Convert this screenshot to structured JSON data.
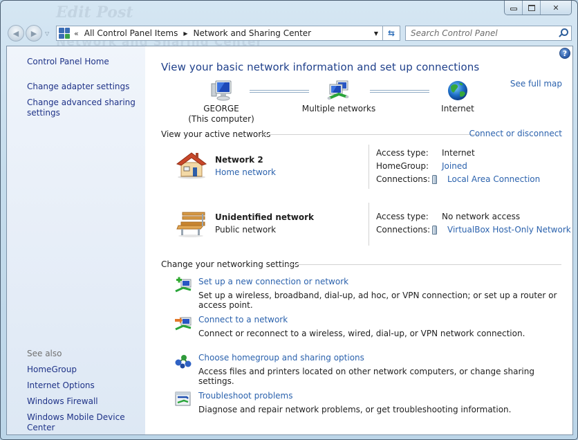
{
  "window": {
    "background_title": "Edit Post",
    "background_subtitle": "Network and Sharing Center",
    "caption": {
      "minimize_icon": "minimize-icon",
      "maximize_icon": "maximize-icon",
      "close_icon": "close-icon",
      "close_glyph": "✕"
    }
  },
  "navigation": {
    "back_icon": "back-arrow-icon",
    "forward_icon": "forward-arrow-icon",
    "history_glyph": "▽",
    "back_glyph": "◀",
    "forward_glyph": "▶"
  },
  "address": {
    "overflow_glyph": "«",
    "separator_glyph": "▶",
    "dropdown_glyph": "▼",
    "breadcrumbs": [
      "All Control Panel Items",
      "Network and Sharing Center"
    ],
    "refresh_glyph": "⇆"
  },
  "search": {
    "placeholder": "Search Control Panel",
    "value": ""
  },
  "sidebar": {
    "home": "Control Panel Home",
    "tasks": [
      "Change adapter settings",
      "Change advanced sharing",
      "settings"
    ],
    "see_also_label": "See also",
    "see_also": [
      "HomeGroup",
      "Internet Options",
      "Windows Firewall",
      "Windows Mobile Device Center"
    ]
  },
  "main": {
    "help_glyph": "?",
    "title": "View your basic network information and set up connections",
    "map": {
      "computer_name": "GEORGE",
      "computer_note": "(This computer)",
      "middle": "Multiple networks",
      "internet": "Internet",
      "see_full_map": "See full map"
    },
    "active_networks": {
      "heading": "View your active networks",
      "connect_link": "Connect or disconnect",
      "networks": [
        {
          "name": "Network  2",
          "type": "Home network",
          "type_is_link": true,
          "icon": "house-icon",
          "details": [
            {
              "label": "Access type:",
              "value": "Internet"
            },
            {
              "label": "HomeGroup:",
              "value": "Joined"
            },
            {
              "label": "Connections:",
              "value": "Local Area Connection"
            }
          ]
        },
        {
          "name": "Unidentified network",
          "type": "Public network",
          "type_is_link": false,
          "icon": "bench-icon",
          "details": [
            {
              "label": "Access type:",
              "value": "No network access"
            },
            {
              "label": "Connections:",
              "value": "VirtualBox Host-Only Network"
            }
          ]
        }
      ]
    },
    "settings": {
      "heading": "Change your networking settings",
      "tasks": [
        {
          "title": "Set up a new connection or network",
          "desc": "Set up a wireless, broadband, dial-up, ad hoc, or VPN connection; or set up a router or access point."
        },
        {
          "title": "Connect to a network",
          "desc": "Connect or reconnect to a wireless, wired, dial-up, or VPN network connection."
        },
        {
          "title": "Choose homegroup and sharing options",
          "desc": "Access files and printers located on other network computers, or change sharing settings."
        },
        {
          "title": "Troubleshoot problems",
          "desc": "Diagnose and repair network problems, or get troubleshooting information."
        }
      ]
    }
  },
  "colors": {
    "link": "#2b62ad",
    "sidebar_link": "#1e3287",
    "title": "#1e3f8a",
    "frame": "#c5dcec"
  }
}
